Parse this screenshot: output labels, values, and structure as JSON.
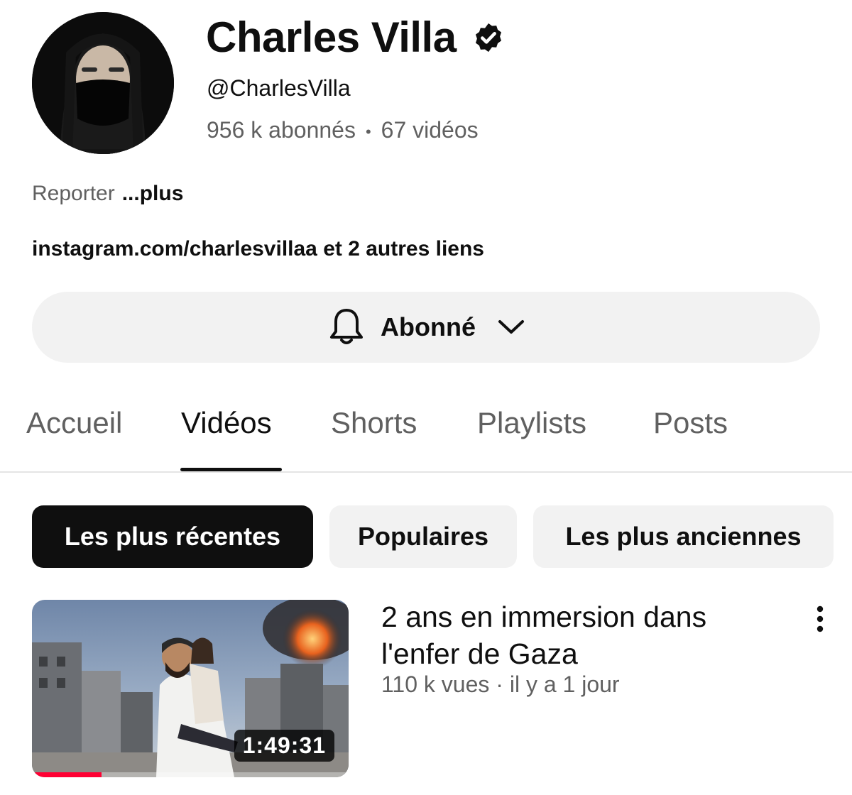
{
  "channel": {
    "name": "Charles Villa",
    "handle": "@CharlesVilla",
    "subscribers": "956 k abonnés",
    "separator": "•",
    "videos_count": "67 vidéos",
    "description": "Reporter",
    "more_label": "...plus",
    "links_text": "instagram.com/charlesvillaa et 2 autres liens",
    "verified_icon": "verified-check-icon"
  },
  "subscribe": {
    "label": "Abonné",
    "bell_icon": "bell-icon",
    "dropdown_icon": "chevron-down-icon",
    "background": "#f2f2f2"
  },
  "tabs": [
    {
      "label": "Accueil",
      "active": false
    },
    {
      "label": "Vidéos",
      "active": true
    },
    {
      "label": "Shorts",
      "active": false
    },
    {
      "label": "Playlists",
      "active": false
    },
    {
      "label": "Posts",
      "active": false
    }
  ],
  "filters": [
    {
      "label": "Les plus récentes",
      "active": true
    },
    {
      "label": "Populaires",
      "active": false
    },
    {
      "label": "Les plus anciennes",
      "active": false
    }
  ],
  "video": {
    "title": "2 ans en immersion dans l'enfer de Gaza",
    "meta": "110 k vues · il y a 1 jour",
    "duration": "1:49:31",
    "watch_progress": 0.22,
    "menu_icon": "more-vertical-icon"
  },
  "colors": {
    "text_primary": "#0f0f0f",
    "text_secondary": "#606060",
    "chip_active": "#0f0f0f",
    "progress_red": "#ff0033"
  }
}
